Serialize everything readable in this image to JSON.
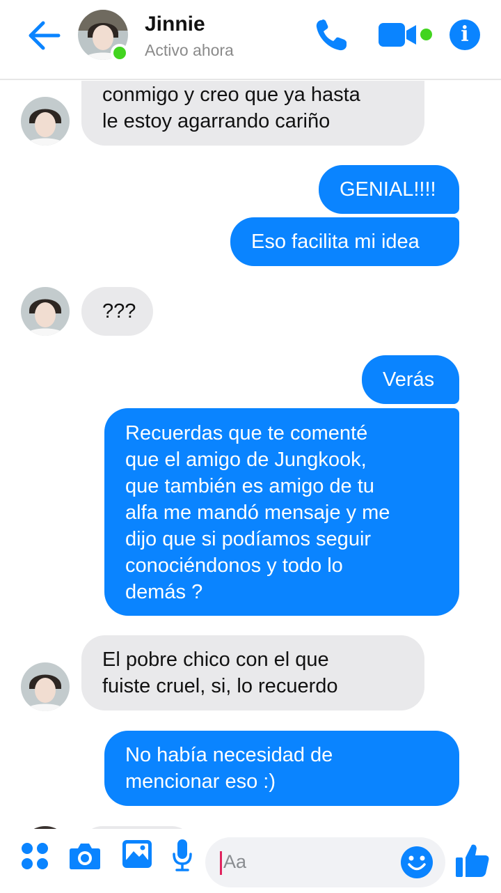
{
  "header": {
    "name": "Jinnie",
    "status": "Activo ahora"
  },
  "messages": [
    {
      "side": "in",
      "lines": [
        "conmigo y creo que ya hasta",
        "le estoy agarrando cariño"
      ],
      "avatar": true
    },
    {
      "side": "out",
      "lines": [
        "GENIAL!!!!"
      ]
    },
    {
      "side": "out",
      "lines": [
        "Eso facilita mi idea"
      ]
    },
    {
      "side": "in",
      "lines": [
        "???"
      ],
      "avatar": true
    },
    {
      "side": "out",
      "lines": [
        "Verás"
      ]
    },
    {
      "side": "out",
      "lines": [
        "Recuerdas que te comenté",
        "que el amigo de Jungkook,",
        "que también es amigo de tu",
        "alfa me mandó mensaje y me",
        "dijo que si podíamos seguir",
        "conociéndonos y todo lo",
        "demás ?"
      ]
    },
    {
      "side": "in",
      "lines": [
        "El pobre chico con el que",
        "fuiste cruel, si, lo recuerdo"
      ],
      "avatar": true
    },
    {
      "side": "out",
      "lines": [
        "No había necesidad de",
        "mencionar eso :)"
      ]
    }
  ],
  "composer": {
    "placeholder": "Aa"
  },
  "colors": {
    "accent": "#0a84ff",
    "online": "#42d41f",
    "incoming_bubble": "#e9e9eb"
  },
  "icons": [
    "back-arrow-icon",
    "phone-icon",
    "video-camera-icon",
    "info-icon",
    "apps-grid-icon",
    "camera-icon",
    "gallery-icon",
    "microphone-icon",
    "emoji-icon",
    "thumbs-up-icon"
  ]
}
